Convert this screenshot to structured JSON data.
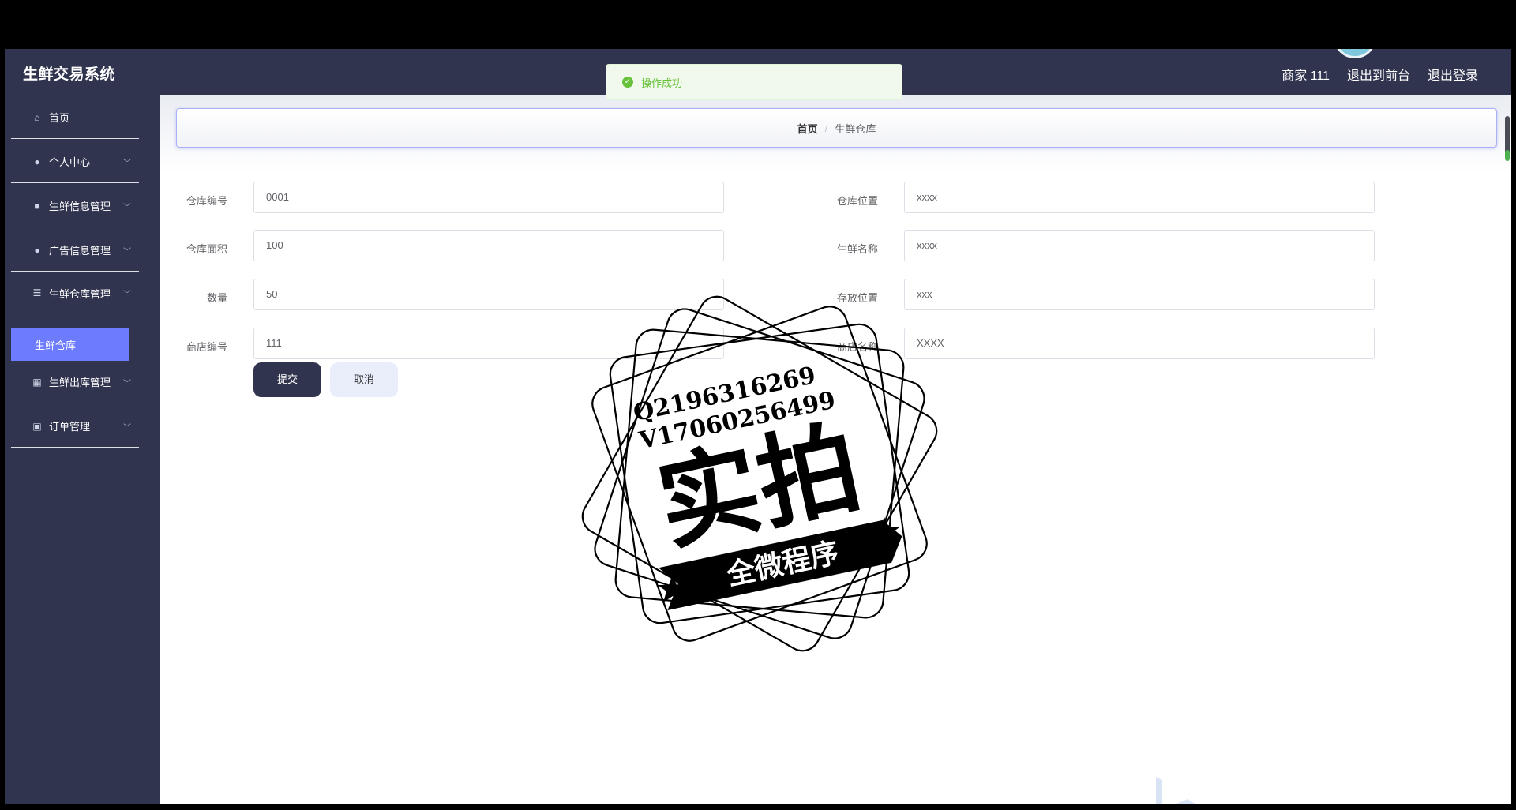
{
  "header": {
    "app_title": "生鲜交易系统",
    "user_label": "商家 111",
    "to_front_label": "退出到前台",
    "logout_label": "退出登录"
  },
  "toast": {
    "icon": "check-circle-icon",
    "text": "操作成功",
    "color": "#67c23a"
  },
  "sidebar": {
    "items": [
      {
        "label": "首页",
        "icon": "home-icon"
      },
      {
        "label": "个人中心",
        "icon": "user-icon"
      },
      {
        "label": "生鲜信息管理",
        "icon": "briefcase-icon"
      },
      {
        "label": "广告信息管理",
        "icon": "user-icon"
      },
      {
        "label": "生鲜仓库管理",
        "icon": "list-icon"
      },
      {
        "label": "生鲜出库管理",
        "icon": "grid-icon"
      },
      {
        "label": "订单管理",
        "icon": "chart-icon"
      }
    ],
    "active_sub": "生鲜仓库"
  },
  "breadcrumb": {
    "home": "首页",
    "separator": "/",
    "current": "生鲜仓库"
  },
  "form": {
    "warehouse_no": {
      "label": "仓库编号",
      "value": "0001"
    },
    "warehouse_location": {
      "label": "仓库位置",
      "value": "xxxx"
    },
    "warehouse_area": {
      "label": "仓库面积",
      "value": "100"
    },
    "produce_name": {
      "label": "生鲜名称",
      "value": "xxxx"
    },
    "quantity": {
      "label": "数量",
      "value": "50"
    },
    "storage_position": {
      "label": "存放位置",
      "value": "xxx"
    },
    "shop_no": {
      "label": "商店编号",
      "value": "111"
    },
    "shop_name": {
      "label": "商店名称",
      "value": "XXXX"
    },
    "submit_label": "提交",
    "cancel_label": "取消"
  },
  "watermark": {
    "line1": "Q2196316269",
    "line2": "V17060256499",
    "big_text": "实拍",
    "ribbon_text": "全微程序"
  },
  "colors": {
    "sidebar_bg": "#30344f",
    "active_item": "#6d7bff",
    "success": "#67c23a"
  }
}
